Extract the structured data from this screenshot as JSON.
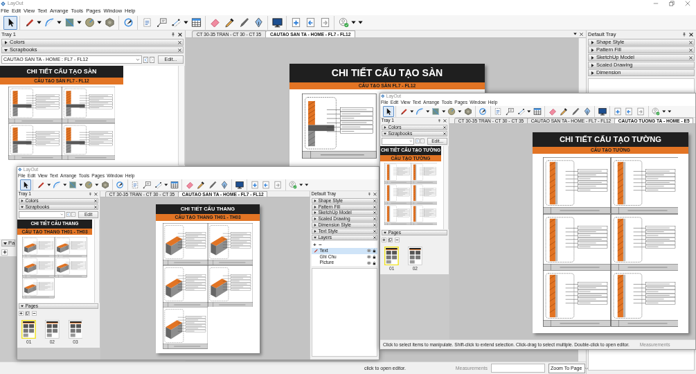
{
  "window": {
    "title": "LayOut"
  },
  "menu": [
    "File",
    "Edit",
    "View",
    "Text",
    "Arrange",
    "Tools",
    "Pages",
    "Window",
    "Help"
  ],
  "toolbar": [
    [
      {
        "kind": "select",
        "selected": true,
        "menu": false,
        "disabled": false
      }
    ],
    [
      {
        "kind": "line",
        "selected": false,
        "menu": true,
        "disabled": false
      },
      {
        "kind": "arc",
        "selected": false,
        "menu": true,
        "disabled": false
      },
      {
        "kind": "rectangle",
        "selected": false,
        "menu": true,
        "disabled": false
      },
      {
        "kind": "circle",
        "selected": false,
        "menu": true,
        "disabled": false
      },
      {
        "kind": "polygon",
        "selected": false,
        "menu": false,
        "disabled": false
      }
    ],
    [
      {
        "kind": "offset",
        "selected": false,
        "menu": false,
        "disabled": false
      }
    ],
    [
      {
        "kind": "text",
        "selected": false,
        "menu": false,
        "disabled": false
      },
      {
        "kind": "label",
        "selected": false,
        "menu": false,
        "disabled": false
      },
      {
        "kind": "dimension",
        "selected": false,
        "menu": true,
        "disabled": false
      },
      {
        "kind": "table",
        "selected": false,
        "menu": false,
        "disabled": false
      }
    ],
    [
      {
        "kind": "eraser",
        "selected": false,
        "menu": false,
        "disabled": false
      },
      {
        "kind": "style",
        "selected": false,
        "menu": false,
        "disabled": false
      },
      {
        "kind": "split",
        "selected": false,
        "menu": false,
        "disabled": false
      },
      {
        "kind": "join",
        "selected": false,
        "menu": false,
        "disabled": false
      }
    ],
    [
      {
        "kind": "present",
        "selected": false,
        "menu": false,
        "disabled": false
      }
    ],
    [
      {
        "kind": "add_page",
        "selected": false,
        "menu": false,
        "disabled": false
      },
      {
        "kind": "previous_page",
        "selected": false,
        "menu": false,
        "disabled": false
      },
      {
        "kind": "next_page",
        "selected": false,
        "menu": false,
        "disabled": true
      }
    ],
    [
      {
        "kind": "account",
        "selected": false,
        "menu": true,
        "disabled": false
      }
    ]
  ],
  "left_tray": {
    "title": "Tray 1",
    "panels": [
      {
        "title": "Colors",
        "expanded": false,
        "closable": true
      },
      {
        "title": "Scrapbooks",
        "expanded": true,
        "closable": true
      }
    ],
    "scrapbook": {
      "value": "CAUTAO SAN TA - HOME : FL7 - FL12",
      "button": "Edit..."
    },
    "preview": {
      "kind": "floor",
      "title": "CHI TIẾT CẤU TẠO SÀN",
      "subtitle": "CẤU TẠO SÀN FL7 - FL12"
    },
    "pages": {
      "title": "Pa",
      "expanded": true
    }
  },
  "tabs": [
    {
      "label": "CT 30-35 TRAN - CT 30 - CT 35",
      "selected": false
    },
    {
      "label": "CAUTAO SAN TA - HOME - FL7 - FL12",
      "selected": true
    }
  ],
  "canvas": {
    "page": {
      "kind": "floor",
      "title": "CHI TIẾT CẤU TẠO SÀN",
      "subtitle": "CẤU TẠO SÀN FL7 - FL12"
    }
  },
  "right_tray": {
    "title": "Default Tray",
    "panels": [
      {
        "title": "Shape Style",
        "expanded": false,
        "closable": true
      },
      {
        "title": "Pattern Fill",
        "expanded": false,
        "closable": true
      },
      {
        "title": "SketchUp Model",
        "expanded": false,
        "closable": true
      },
      {
        "title": "Scaled Drawing",
        "expanded": false,
        "closable": false
      },
      {
        "title": "Dimension",
        "expanded": false,
        "closable": false
      }
    ]
  },
  "status_bar": {
    "text": "click to open editor.",
    "measurements_label": "Measurements",
    "zoom": "Zoom To Page"
  },
  "screenshots": [
    {
      "window": {
        "title": "LayOut"
      },
      "menu": [
        "File",
        "Edit",
        "View",
        "Text",
        "Arrange",
        "Tools",
        "Pages",
        "Window",
        "Help"
      ],
      "toolbar": [
        [
          {
            "kind": "select",
            "selected": true,
            "menu": false,
            "disabled": false
          }
        ],
        [
          {
            "kind": "line",
            "selected": false,
            "menu": true,
            "disabled": false
          },
          {
            "kind": "arc",
            "selected": false,
            "menu": true,
            "disabled": false
          },
          {
            "kind": "rectangle",
            "selected": false,
            "menu": true,
            "disabled": false
          },
          {
            "kind": "circle",
            "selected": false,
            "menu": true,
            "disabled": false
          },
          {
            "kind": "polygon",
            "selected": false,
            "menu": false,
            "disabled": false
          }
        ],
        [
          {
            "kind": "offset",
            "selected": false,
            "menu": false,
            "disabled": false
          }
        ],
        [
          {
            "kind": "text",
            "selected": false,
            "menu": false,
            "disabled": false
          },
          {
            "kind": "label",
            "selected": false,
            "menu": false,
            "disabled": false
          },
          {
            "kind": "dimension",
            "selected": false,
            "menu": true,
            "disabled": false
          },
          {
            "kind": "table",
            "selected": false,
            "menu": false,
            "disabled": false
          }
        ],
        [
          {
            "kind": "eraser",
            "selected": false,
            "menu": false,
            "disabled": false
          },
          {
            "kind": "style",
            "selected": false,
            "menu": false,
            "disabled": false
          },
          {
            "kind": "split",
            "selected": false,
            "menu": false,
            "disabled": false
          },
          {
            "kind": "join",
            "selected": false,
            "menu": false,
            "disabled": false
          }
        ],
        [
          {
            "kind": "present",
            "selected": false,
            "menu": false,
            "disabled": false
          }
        ],
        [
          {
            "kind": "add_page",
            "selected": false,
            "menu": false,
            "disabled": false
          },
          {
            "kind": "previous_page",
            "selected": false,
            "menu": false,
            "disabled": false
          },
          {
            "kind": "next_page",
            "selected": false,
            "menu": false,
            "disabled": true
          }
        ],
        [
          {
            "kind": "account",
            "selected": false,
            "menu": true,
            "disabled": false
          }
        ]
      ],
      "left_tray": {
        "title": "Tray 1",
        "panels": [
          {
            "title": "Colors",
            "expanded": false,
            "closable": true
          },
          {
            "title": "Scrapbooks",
            "expanded": true,
            "closable": true
          }
        ],
        "scrapbook": {
          "button": "Edit"
        },
        "preview": {
          "kind": "stair",
          "title": "CHI TIẾT CẤU THANG",
          "subtitle": "CẤU TẠO THANG TH01 - TH03"
        },
        "pages": {
          "title": "Pages",
          "expanded": true,
          "items": [
            {
              "label": "01",
              "selected": true
            },
            {
              "label": "02",
              "selected": false
            },
            {
              "label": "03",
              "selected": false
            }
          ]
        }
      },
      "tabs": [
        {
          "label": "CT 30-35 TRAN - CT 30 - CT 35",
          "selected": false
        },
        {
          "label": "CAUTAO SAN TA - HOME - FL7 - FL12",
          "selected": true
        }
      ],
      "canvas": {
        "page": {
          "kind": "stair",
          "title": "CHI TIẾT CẤU THANG",
          "subtitle": "CẤU TẠO THANG TH01 - TH03"
        }
      },
      "right_tray": {
        "title": "Default Tray",
        "panels": [
          {
            "title": "Shape Style",
            "expanded": false,
            "closable": true
          },
          {
            "title": "Pattern Fill",
            "expanded": false,
            "closable": true
          },
          {
            "title": "SketchUp Model",
            "expanded": false,
            "closable": true
          },
          {
            "title": "Scaled Drawing",
            "expanded": false,
            "closable": true
          },
          {
            "title": "Dimension Style",
            "expanded": false,
            "closable": true
          },
          {
            "title": "Text Style",
            "expanded": false,
            "closable": true
          },
          {
            "title": "Layers",
            "expanded": true,
            "closable": true
          }
        ],
        "layers": [
          {
            "name": "Text",
            "selected": true
          },
          {
            "name": "Ghi Chu",
            "selected": false
          },
          {
            "name": "Picture",
            "selected": false
          }
        ]
      }
    },
    {
      "window": {
        "title": "LayOut"
      },
      "menu": [
        "File",
        "Edit",
        "View",
        "Text",
        "Arrange",
        "Tools",
        "Pages",
        "Window",
        "Help"
      ],
      "toolbar": [
        [
          {
            "kind": "select",
            "selected": true,
            "menu": false,
            "disabled": false
          }
        ],
        [
          {
            "kind": "line",
            "selected": false,
            "menu": true,
            "disabled": false
          },
          {
            "kind": "arc",
            "selected": false,
            "menu": true,
            "disabled": false
          },
          {
            "kind": "rectangle",
            "selected": false,
            "menu": true,
            "disabled": false
          },
          {
            "kind": "circle",
            "selected": false,
            "menu": true,
            "disabled": false
          },
          {
            "kind": "polygon",
            "selected": false,
            "menu": false,
            "disabled": false
          }
        ],
        [
          {
            "kind": "offset",
            "selected": false,
            "menu": false,
            "disabled": false
          }
        ],
        [
          {
            "kind": "text",
            "selected": false,
            "menu": false,
            "disabled": false
          },
          {
            "kind": "label",
            "selected": false,
            "menu": false,
            "disabled": false
          },
          {
            "kind": "dimension",
            "selected": false,
            "menu": true,
            "disabled": false
          },
          {
            "kind": "table",
            "selected": false,
            "menu": false,
            "disabled": false
          }
        ],
        [
          {
            "kind": "eraser",
            "selected": false,
            "menu": false,
            "disabled": false
          },
          {
            "kind": "style",
            "selected": false,
            "menu": false,
            "disabled": false
          },
          {
            "kind": "split",
            "selected": false,
            "menu": false,
            "disabled": false
          },
          {
            "kind": "join",
            "selected": false,
            "menu": false,
            "disabled": false
          }
        ],
        [
          {
            "kind": "present",
            "selected": false,
            "menu": false,
            "disabled": false
          }
        ],
        [
          {
            "kind": "add_page",
            "selected": false,
            "menu": false,
            "disabled": false
          },
          {
            "kind": "previous_page",
            "selected": false,
            "menu": false,
            "disabled": false
          },
          {
            "kind": "next_page",
            "selected": false,
            "menu": false,
            "disabled": true
          }
        ],
        [
          {
            "kind": "account",
            "selected": false,
            "menu": true,
            "disabled": false
          }
        ]
      ],
      "left_tray": {
        "title": "Tray 1",
        "panels": [
          {
            "title": "Colors",
            "expanded": false,
            "closable": true
          },
          {
            "title": "Scrapbooks",
            "expanded": true,
            "closable": true
          }
        ],
        "scrapbook": {
          "button": "Edit..."
        },
        "preview": {
          "kind": "wall",
          "title": "CHI TIẾT CẤU TẠO TƯỜNG",
          "subtitle": "CẤU TẠO TƯỜNG"
        },
        "pages": {
          "title": "Pages",
          "expanded": true,
          "items": [
            {
              "label": "01",
              "selected": true
            },
            {
              "label": "02",
              "selected": false
            }
          ]
        }
      },
      "tabs": [
        {
          "label": "CT 30-35 TRAN - CT 30 - CT 35",
          "selected": false
        },
        {
          "label": "CAUTAO SAN TA - HOME - FL7 - FL12",
          "selected": false
        },
        {
          "label": "CAUTAO TUONG TA - HOME - E5",
          "selected": true
        }
      ],
      "canvas": {
        "page": {
          "kind": "wall",
          "title": "CHI TIẾT CẤU TẠO TƯỜNG",
          "subtitle": "CẤU TẠO TƯỜNG"
        }
      },
      "status_bar": {
        "text": "Click to select items to manipulate. Shift-click to extend selection. Click-drag to select multiple. Double-click to open editor.",
        "measurements_label": "Measurements"
      }
    }
  ]
}
